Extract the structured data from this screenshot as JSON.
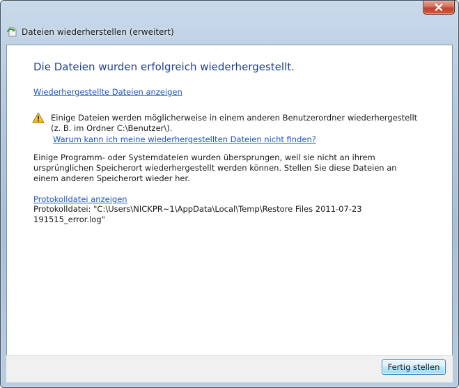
{
  "window": {
    "title": "Dateien wiederherstellen (erweitert)",
    "title_icon": "restore-files-icon",
    "close_icon": "close-icon"
  },
  "main": {
    "heading": "Die Dateien wurden erfolgreich wiederhergestellt.",
    "view_restored_link": "Wiederhergestellte Dateien anzeigen",
    "warning": {
      "icon": "warning-icon",
      "text": "Einige Dateien werden möglicherweise in einem anderen Benutzerordner wiederhergestellt (z. B. im Ordner C:\\Benutzer\\).",
      "help_link": "Warum kann ich meine wiederhergestellten Dateien nicht finden?"
    },
    "skipped_info": "Einige Programm- oder Systemdateien wurden übersprungen, weil sie nicht an ihrem ursprünglichen Speicherort wiederhergestellt werden können. Stellen Sie diese Dateien an einem anderen Speicherort wieder her.",
    "log_link": "Protokolldatei anzeigen",
    "log_path": "Protokolldatei: \"C:\\Users\\NICKPR~1\\AppData\\Local\\Temp\\Restore Files 2011-07-23 191515_error.log\""
  },
  "footer": {
    "finish_label": "Fertig stellen"
  },
  "colors": {
    "heading": "#1e3d8f",
    "link": "#1c55b8",
    "close_button": "#c0422c"
  }
}
